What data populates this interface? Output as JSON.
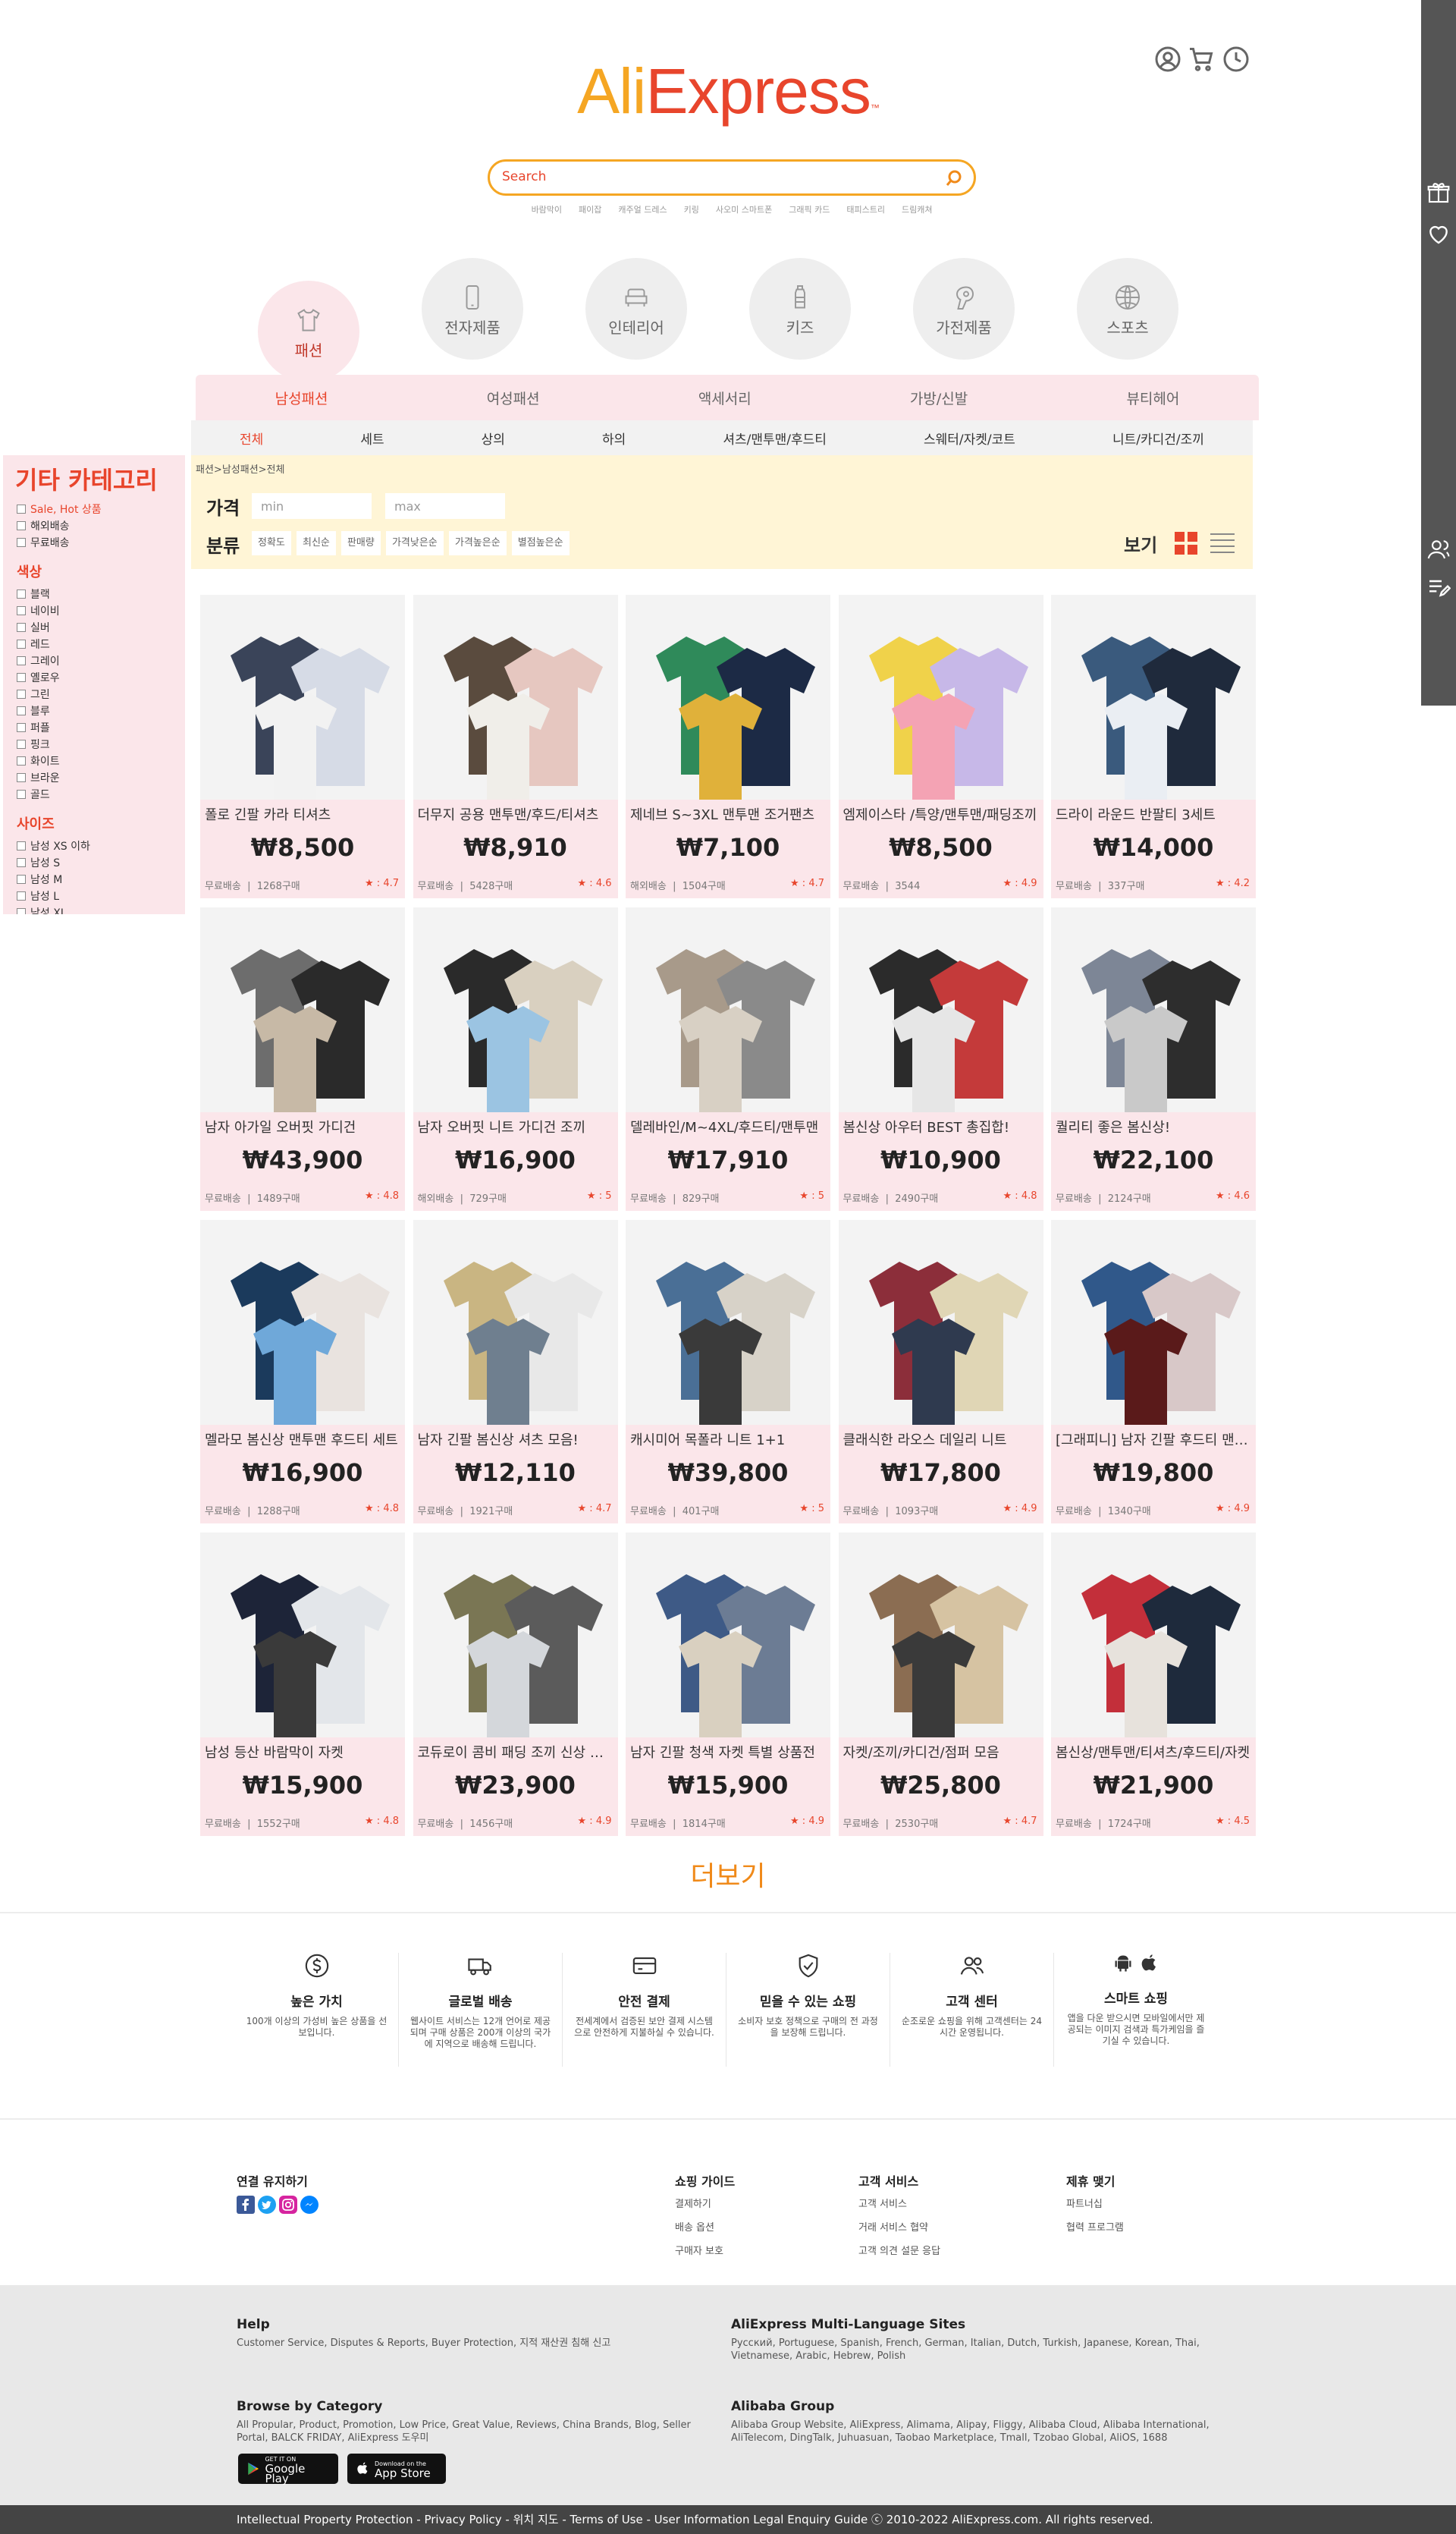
{
  "header": {
    "logo_a": "Ali",
    "logo_b": "Express",
    "logo_tm": "™"
  },
  "search": {
    "placeholder": "Search",
    "chips": [
      "바람막이",
      "패이잡",
      "캐주얼 드레스",
      "키링",
      "사오미 스마트폰",
      "그래픽 카드",
      "태피스트리",
      "드림캐쳐"
    ]
  },
  "categories": [
    {
      "label": "패션",
      "icon": "tshirt-icon"
    },
    {
      "label": "전자제품",
      "icon": "phone-icon"
    },
    {
      "label": "인테리어",
      "icon": "sofa-icon"
    },
    {
      "label": "키즈",
      "icon": "bottle-icon"
    },
    {
      "label": "가전제품",
      "icon": "hairdryer-icon"
    },
    {
      "label": "스포츠",
      "icon": "ball-icon"
    }
  ],
  "subnav": [
    "남성패션",
    "여성패션",
    "액세서리",
    "가방/신발",
    "뷰티헤어"
  ],
  "subnav2": [
    "전체",
    "세트",
    "상의",
    "하의",
    "셔츠/맨투맨/후드티",
    "스웨터/자켓/코트",
    "니트/카디건/조끼"
  ],
  "filter": {
    "breadcrumb": "패션>남성패션>전체",
    "price_label": "가격",
    "min_placeholder": "min",
    "max_placeholder": "max",
    "sort_label": "분류",
    "sort_options": [
      "정확도",
      "최신순",
      "판매량",
      "가격낮은순",
      "가격높은순",
      "별점높은순"
    ],
    "view_label": "보기"
  },
  "sidebar": {
    "title": "기타 카테고리",
    "top_options": [
      "Sale, Hot 상품",
      "해외배송",
      "무료배송"
    ],
    "color_title": "색상",
    "colors": [
      "블랙",
      "네이비",
      "실버",
      "레드",
      "그레이",
      "옐로우",
      "그린",
      "블루",
      "퍼플",
      "핑크",
      "화이트",
      "브라운",
      "골드"
    ],
    "size_title": "사이즈",
    "sizes": [
      "남성 XS 이하",
      "남성 S",
      "남성 M",
      "남성 L",
      "남성 XL"
    ]
  },
  "products": [
    {
      "title": "폴로 긴팔 카라 티셔츠",
      "price": "₩8,500",
      "ship": "무료배송",
      "sold": "1268구매",
      "rating": "★ : 4.7"
    },
    {
      "title": "더무지 공용 맨투맨/후드/티셔츠",
      "price": "₩8,910",
      "ship": "무료배송",
      "sold": "5428구매",
      "rating": "★ : 4.6"
    },
    {
      "title": "제네브 S~3XL 맨투맨 조거팬츠",
      "price": "₩7,100",
      "ship": "해외배송",
      "sold": "1504구매",
      "rating": "★ : 4.7"
    },
    {
      "title": "엠제이스타 /특양/맨투맨/패딩조끼",
      "price": "₩8,500",
      "ship": "무료배송",
      "sold": "3544",
      "rating": "★ : 4.9"
    },
    {
      "title": "드라이 라운드 반팔티 3세트",
      "price": "₩14,000",
      "ship": "무료배송",
      "sold": "337구매",
      "rating": "★ : 4.2"
    },
    {
      "title": "남자 아가일 오버핏 가디건",
      "price": "₩43,900",
      "ship": "무료배송",
      "sold": "1489구매",
      "rating": "★ : 4.8"
    },
    {
      "title": "남자 오버핏 니트 가디건 조끼",
      "price": "₩16,900",
      "ship": "해외배송",
      "sold": "729구매",
      "rating": "★ : 5"
    },
    {
      "title": "델레바인/M~4XL/후드티/맨투맨",
      "price": "₩17,910",
      "ship": "무료배송",
      "sold": "829구매",
      "rating": "★ : 5"
    },
    {
      "title": "봄신상 아우터 BEST 총집합!",
      "price": "₩10,900",
      "ship": "무료배송",
      "sold": "2490구매",
      "rating": "★ : 4.8"
    },
    {
      "title": "퀄리티 좋은 봄신상!",
      "price": "₩22,100",
      "ship": "무료배송",
      "sold": "2124구매",
      "rating": "★ : 4.6"
    },
    {
      "title": "멜라모 봄신상 맨투맨 후드티 세트",
      "price": "₩16,900",
      "ship": "무료배송",
      "sold": "1288구매",
      "rating": "★ : 4.8"
    },
    {
      "title": "남자 긴팔 봄신상 셔츠 모음!",
      "price": "₩12,110",
      "ship": "무료배송",
      "sold": "1921구매",
      "rating": "★ : 4.7"
    },
    {
      "title": "캐시미어 목폴라 니트 1+1",
      "price": "₩39,800",
      "ship": "무료배송",
      "sold": "401구매",
      "rating": "★ : 5"
    },
    {
      "title": "클래식한 라오스 데일리 니트",
      "price": "₩17,800",
      "ship": "무료배송",
      "sold": "1093구매",
      "rating": "★ : 4.9"
    },
    {
      "title": "[그래피니] 남자 긴팔 후드티 맨투맨",
      "price": "₩19,800",
      "ship": "무료배송",
      "sold": "1340구매",
      "rating": "★ : 4.9"
    },
    {
      "title": "남성 등산 바람막이 자켓",
      "price": "₩15,900",
      "ship": "무료배송",
      "sold": "1552구매",
      "rating": "★ : 4.8"
    },
    {
      "title": "코듀로이 콤비 패딩 조끼 신상 점퍼",
      "price": "₩23,900",
      "ship": "무료배송",
      "sold": "1456구매",
      "rating": "★ : 4.9"
    },
    {
      "title": "남자 긴팔 청색 자켓 특별 상품전",
      "price": "₩15,900",
      "ship": "무료배송",
      "sold": "1814구매",
      "rating": "★ : 4.9"
    },
    {
      "title": "자켓/조끼/카디건/점퍼 모음",
      "price": "₩25,800",
      "ship": "무료배송",
      "sold": "2530구매",
      "rating": "★ : 4.7"
    },
    {
      "title": "봄신상/맨투맨/티셔츠/후드티/자켓",
      "price": "₩21,900",
      "ship": "무료배송",
      "sold": "1724구매",
      "rating": "★ : 4.5"
    }
  ],
  "more_label": "더보기",
  "features": [
    {
      "title": "높은 가치",
      "desc": "100개 이상의 가성비 높은 상품을 선보입니다."
    },
    {
      "title": "글로벌 배송",
      "desc": "웹사이트 서비스는 12개 언어로 제공되며 구매 상품은 200개 이상의 국가에 지역으로 배송해 드립니다."
    },
    {
      "title": "안전 결제",
      "desc": "전세계에서 검증된 보안 결제 시스템으로 안전하게 지불하실 수 있습니다."
    },
    {
      "title": "믿을 수 있는 쇼핑",
      "desc": "소비자 보호 정책으로 구매의 전 과정을 보장해 드립니다."
    },
    {
      "title": "고객 센터",
      "desc": "순조로운 쇼핑을 위해 고객센터는 24시간 운영됩니다."
    },
    {
      "title": "스마트 쇼핑",
      "desc": "앱을 다운 받으시면 모바일에서만 제공되는 이미지 검색과 특가케임을 즐기실 수 있습니다."
    }
  ],
  "links": {
    "contact_title": "연결 유지하기",
    "guide_title": "쇼핑 가이드",
    "guide_items": [
      "결제하기",
      "배송 옵션",
      "구매자 보호"
    ],
    "cs_title": "고객 서비스",
    "cs_items": [
      "고객 서비스",
      "거래 서비스 협약",
      "고객 의견 설문 응답"
    ],
    "partner_title": "제휴 맺기",
    "partner_items": [
      "파트너십",
      "협력 프로그램"
    ]
  },
  "footer": {
    "help_title": "Help",
    "help_text": "Customer Service, Disputes & Reports, Buyer Protection, 지적 재산권 침해 신고",
    "multi_title": "AliExpress Multi-Language Sites",
    "multi_text": "Pусский, Portuguese, Spanish, French, German, Italian, Dutch, Turkish, Japanese, Korean, Thai, Vietnamese, Arabic, Hebrew, Polish",
    "browse_title": "Browse by Category",
    "browse_text": "All Propular, Product, Promotion, Low Price, Great Value, Reviews, China Brands, Blog, Seller Portal, BALCK FRIDAY, AliExpress 도우미",
    "group_title": "Alibaba Group",
    "group_text": "Alibaba Group Website, AliExpress, Alimama, Alipay, Fliggy, Alibaba Cloud, Alibaba International, AliTelecom, DingTalk, Juhuasuan, Taobao Marketplace, Tmall, Tzobao Global, AliOS, 1688",
    "gp_small": "GET IT ON",
    "gp": "Google Play",
    "as_small": "Download on the",
    "as": "App Store",
    "bottom": "Intellectual Property Protection - Privacy Policy - 위치 지도 - Terms of Use - User Information Legal Enquiry Guide ⓒ 2010-2022 AliExpress.com. All rights reserved."
  },
  "colors": {
    "accent": "#e8452c",
    "orange": "#f5a623",
    "pink": "#fbe6ea",
    "cream": "#fff5d6"
  }
}
